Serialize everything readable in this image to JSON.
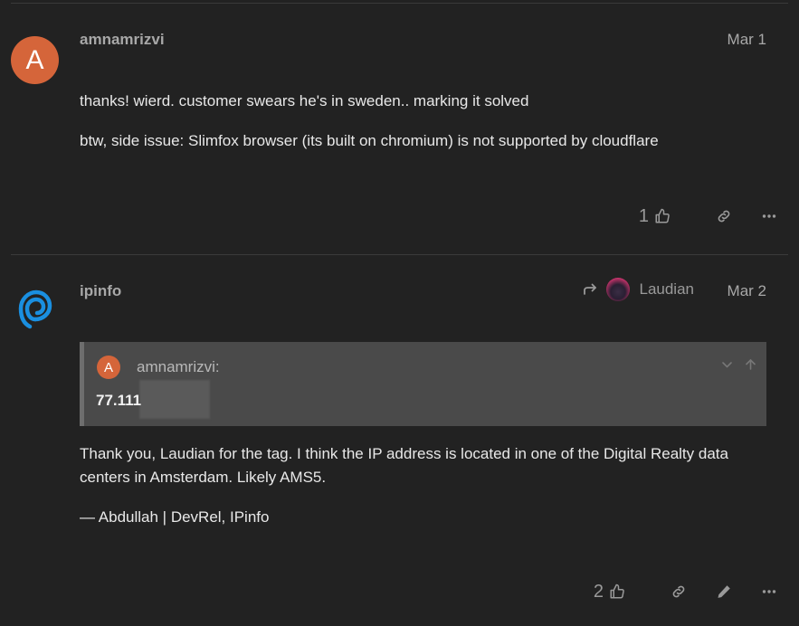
{
  "posts": [
    {
      "username": "amnamrizvi",
      "avatar_letter": "A",
      "date": "Mar 1",
      "paragraphs": [
        "thanks! wierd. customer swears he's in sweden.. marking it solved",
        "btw, side issue: Slimfox browser (its built on chromium) is not supported by cloudflare"
      ],
      "like_count": "1"
    },
    {
      "username": "ipinfo",
      "date": "Mar 2",
      "reply_to": "Laudian",
      "quote": {
        "avatar_letter": "A",
        "username": "amnamrizvi:",
        "text": "77.111"
      },
      "paragraphs": [
        "Thank you, Laudian for the tag. I think the IP address is located in one of the Digital Realty data centers in Amsterdam. Likely AMS5.",
        "— Abdullah | DevRel, IPinfo"
      ],
      "like_count": "2"
    }
  ],
  "colors": {
    "background": "#222222",
    "avatar_orange": "#d5653a",
    "ipinfo_blue": "#1a8fe0",
    "quote_bg": "#4a4a4a"
  },
  "icons": {
    "like": "thumbs-up-icon",
    "link": "link-icon",
    "more": "ellipsis-icon",
    "edit": "pencil-icon",
    "reply": "reply-arrow-icon"
  }
}
